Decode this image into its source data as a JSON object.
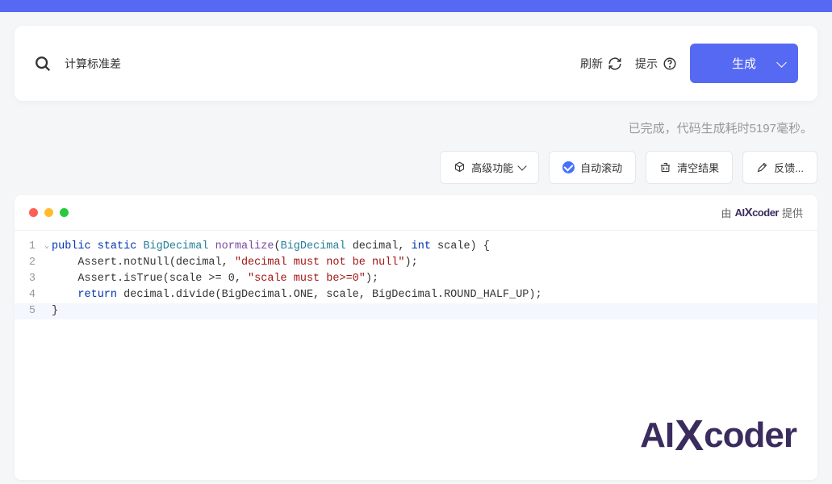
{
  "search": {
    "value": "计算标准差",
    "placeholder": ""
  },
  "actions": {
    "refresh": "刷新",
    "hint": "提示",
    "generate": "生成"
  },
  "status": "已完成，代码生成耗时5197毫秒。",
  "toolbar": {
    "advanced": "高级功能",
    "autoscroll": "自动滚动",
    "clear": "清空结果",
    "feedback": "反馈..."
  },
  "attribution": {
    "prefix": "由",
    "brand": "AIXcoder",
    "suffix": "提供"
  },
  "code": {
    "lines": [
      {
        "n": "1",
        "fold": "⌄",
        "html": "<span class=\"kw\">public</span> <span class=\"kw\">static</span> <span class=\"type\">BigDecimal</span> <span class=\"fn\">normalize</span>(<span class=\"param-type\">BigDecimal</span> decimal, <span class=\"kw-int\">int</span> scale) {"
      },
      {
        "n": "2",
        "fold": "",
        "html": "    Assert.notNull(decimal, <span class=\"str\">\"decimal must not be null\"</span>);"
      },
      {
        "n": "3",
        "fold": "",
        "html": "    Assert.isTrue(scale &gt;= 0, <span class=\"str\">\"scale must be&gt;=0\"</span>);"
      },
      {
        "n": "4",
        "fold": "",
        "html": "    <span class=\"kw\">return</span> decimal.divide(BigDecimal.ONE, scale, BigDecimal.ROUND_HALF_UP);"
      },
      {
        "n": "5",
        "fold": "",
        "html": "}",
        "current": true
      }
    ]
  },
  "watermark": {
    "a": "AI",
    "x": "X",
    "b": "coder"
  }
}
